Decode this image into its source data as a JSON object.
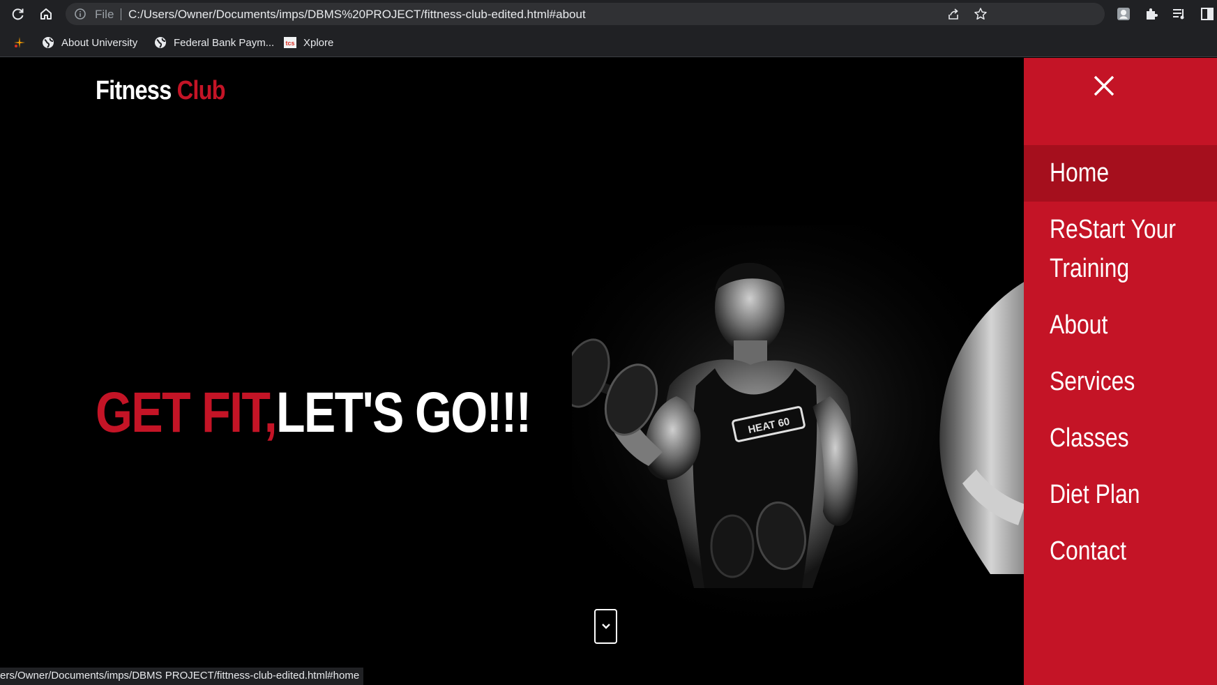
{
  "browser": {
    "url_scheme_label": "File",
    "url": "C:/Users/Owner/Documents/imps/DBMS%20PROJECT/fittness-club-edited.html#about",
    "bookmarks": [
      {
        "label": "About University",
        "icon": "globe-icon"
      },
      {
        "label": "Federal Bank Paym...",
        "icon": "globe-icon"
      },
      {
        "label": "Xplore",
        "icon": "tcs-icon"
      }
    ],
    "status_url": "ers/Owner/Documents/imps/DBMS PROJECT/fittness-club-edited.html#home"
  },
  "site": {
    "logo_part1": "Fitness",
    "logo_part2": "Club",
    "headline_part1": "GET FIT,",
    "headline_part2": "LET'S GO!!!",
    "menu": [
      {
        "label": "Home",
        "active": true
      },
      {
        "label": "ReStart Your Training",
        "line1": "ReStart Your",
        "line2": "Training"
      },
      {
        "label": "About"
      },
      {
        "label": "Services"
      },
      {
        "label": "Classes"
      },
      {
        "label": "Diet Plan"
      },
      {
        "label": "Contact"
      }
    ]
  },
  "colors": {
    "accent": "#c41426",
    "accent_dark": "#a50f1d",
    "background": "#000000",
    "chrome": "#202124"
  }
}
